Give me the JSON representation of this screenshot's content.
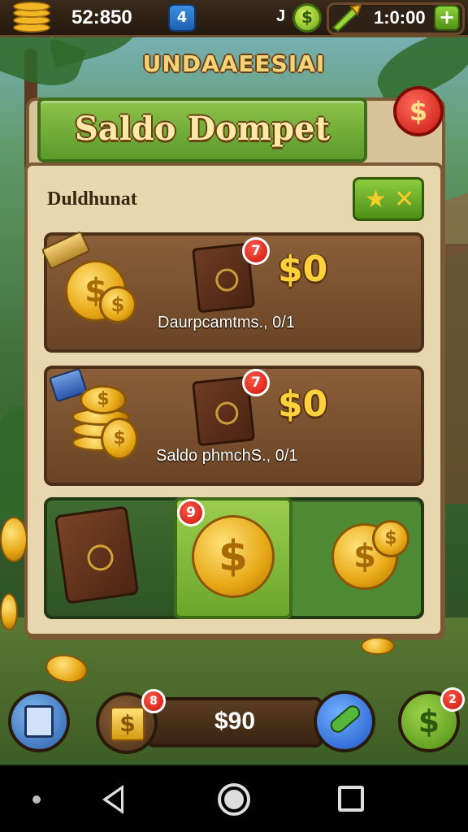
{
  "top_bar": {
    "balance": "52:850",
    "center_glyph": "J",
    "timer": "1:0:00",
    "plus_label": "+",
    "blue_button_glyph": "4"
  },
  "banner": {
    "title": "UNDAAEESIAI"
  },
  "header": {
    "title": "Saldo Dompet",
    "coin_symbol": "$"
  },
  "panel": {
    "section_label": "Duldhunat",
    "star_button": {
      "star": "★",
      "cross": "✕"
    }
  },
  "offers": [
    {
      "price": "$0",
      "badge": "7",
      "description": "Daurpcamtms., 0/1",
      "coin_symbol": "$"
    },
    {
      "price": "$0",
      "badge": "7",
      "description": "Saldo phmchS., 0/1",
      "coin_symbol": "$"
    }
  ],
  "featured": {
    "badge": "9",
    "coin_symbol": "$"
  },
  "bottom_bar": {
    "balance": "$90",
    "gold_badge": "8",
    "right_badge": "2",
    "gold_symbol": "$",
    "green_symbol": "$"
  },
  "colors": {
    "accent_green": "#6aa62a",
    "accent_gold": "#ffd13a",
    "badge_red": "#c8140c",
    "wood_brown": "#6a4426"
  },
  "icons": [
    "coin-stack-icon",
    "info-icon",
    "gem-icon",
    "candy-icon",
    "plus-icon",
    "dollar-coin-icon",
    "star-icon",
    "close-icon",
    "book-icon",
    "rocket-icon",
    "shop-icon"
  ]
}
